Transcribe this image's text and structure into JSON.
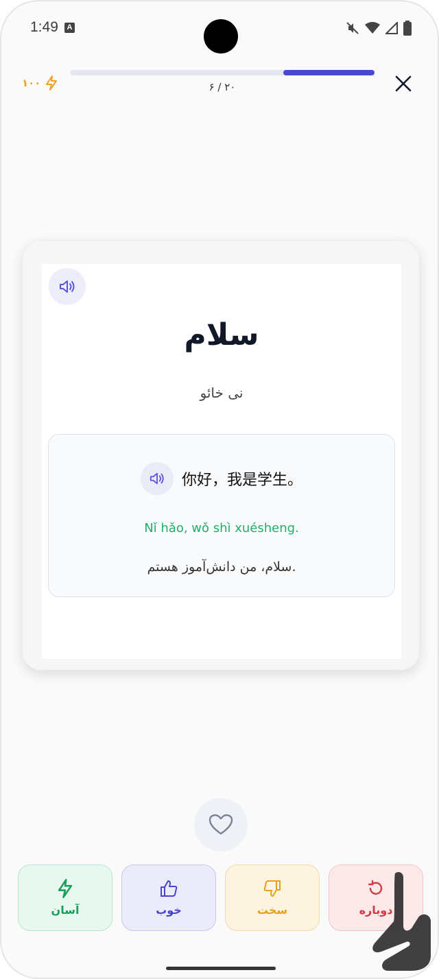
{
  "status_bar": {
    "time": "1:49",
    "badge": "A"
  },
  "header": {
    "xp": "۱۰۰",
    "progress_label": "۶ / ۲۰",
    "progress_fraction": 0.3
  },
  "card": {
    "word": "سلام",
    "transliteration": "نی خائو",
    "example": {
      "chinese": "你好，我是学生。",
      "pinyin": "Nǐ hǎo, wǒ shì xuésheng.",
      "persian": "سلام، من دانش‌آموز هستم."
    }
  },
  "ratings": {
    "easy": "آسان",
    "good": "خوب",
    "hard": "سخت",
    "again": "دوباره"
  },
  "colors": {
    "accent": "#4b47d6",
    "easy": "#18a05a",
    "good": "#4444cc",
    "hard": "#e6a21c",
    "again": "#d23b44"
  }
}
